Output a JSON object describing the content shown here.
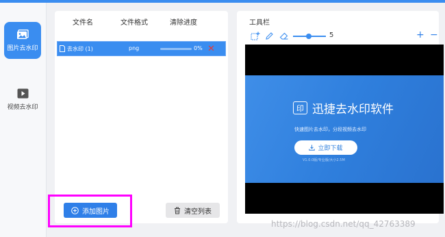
{
  "sidebar": {
    "items": [
      {
        "label": "图片去水印",
        "icon": "image-icon",
        "active": true
      },
      {
        "label": "视频去水印",
        "icon": "video-play-icon",
        "active": false
      }
    ]
  },
  "file_list": {
    "columns": [
      "文件名",
      "文件格式",
      "清除进度"
    ],
    "rows": [
      {
        "name": "去水印 (1)",
        "format": "png",
        "progress_label": "0%",
        "progress": 0
      }
    ]
  },
  "buttons": {
    "add": "添加图片",
    "clear": "清空列表"
  },
  "toolbar": {
    "title": "工具栏",
    "tools": [
      "add-selection-icon",
      "pencil-icon",
      "eraser-icon"
    ],
    "brush_size": "5",
    "zoom_in": "+",
    "zoom_out": "−"
  },
  "preview": {
    "banner_title": "迅捷去水印软件",
    "logo_text": "印",
    "banner_subtitle": "快速图片去水印，分段视频去水印",
    "banner_button": "立即下载",
    "banner_version": "V1.0.0版/专业版/大小2.5M"
  },
  "watermark": "https://blog.csdn.net/qq_42763389",
  "colors": {
    "accent": "#3a8df0",
    "highlight": "#ff00ff",
    "delete": "#e53a3a"
  }
}
